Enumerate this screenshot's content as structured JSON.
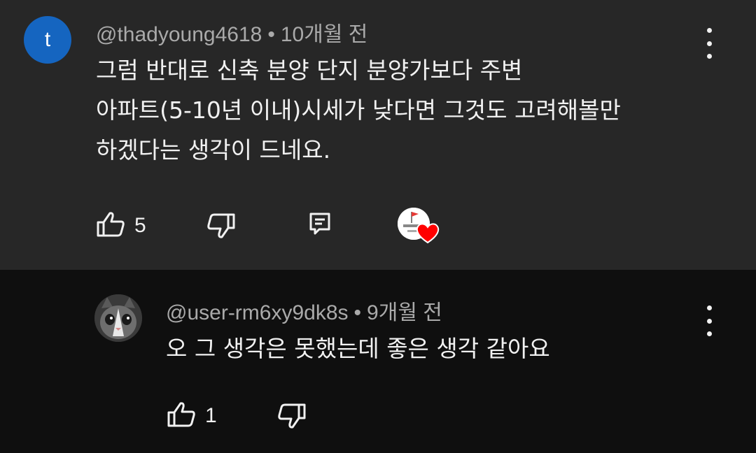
{
  "comment": {
    "avatar_letter": "t",
    "author": "@thadyoung4618",
    "separator": "•",
    "time": "10개월 전",
    "lines": [
      "그럼 반대로 신축 분양 단지 분양가보다 주변",
      "아파트(5-10년 이내)시세가 낮다면 그것도 고려해볼만",
      "하겠다는 생각이 드네요."
    ],
    "like_count": "5",
    "icons": {
      "like": "thumbs-up-icon",
      "dislike": "thumbs-down-icon",
      "reply": "reply-comment-icon",
      "heart": "creator-heart-icon",
      "more": "more-vertical-icon"
    }
  },
  "reply": {
    "author": "@user-rm6xy9dk8s",
    "separator": "•",
    "time": "9개월 전",
    "text": "오 그 생각은 못했는데 좋은 생각 같아요",
    "like_count": "1",
    "icons": {
      "like": "thumbs-up-icon",
      "dislike": "thumbs-down-icon",
      "more": "more-vertical-icon",
      "avatar": "cat-avatar"
    }
  },
  "colors": {
    "top_background": "#272727",
    "reply_background": "#0f0f0f",
    "avatar_blue": "#1565c0",
    "meta_gray": "#aaaaaa",
    "heart_red": "#ff0000"
  }
}
